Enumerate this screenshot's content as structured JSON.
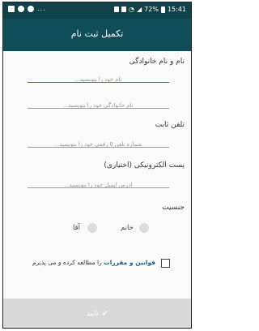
{
  "status_bar": {
    "dots": "...",
    "battery": "72%",
    "time": "15:41"
  },
  "app_bar": {
    "title": "تکمیل ثبت نام"
  },
  "form": {
    "name_section_label": "نام و نام خانوادگی",
    "first_name_placeholder": "نام خود را بنویسید...",
    "last_name_placeholder": "نام خانوادگی خود را بنویسید...",
    "phone_label": "تلفن ثابت",
    "phone_placeholder": "شماره تلفن 8 رقمی خود را بنویسید...",
    "email_label": "پست الکترونیکی (اختیاری)",
    "email_placeholder": "آدرس ایمیل خود را بنویسید...",
    "gender_label": "جنسیت",
    "gender_female": "خانم",
    "gender_male": "آقا",
    "terms_link": "قوانین و مقررات",
    "terms_text": "را مطالعه کرده و می پذیرم"
  },
  "actions": {
    "submit_label": "تایید"
  },
  "colors": {
    "status_bar": "#11424a",
    "app_bar": "#0f4e58",
    "accent": "#1a7a86",
    "disabled_button": "#d9d9d9"
  }
}
